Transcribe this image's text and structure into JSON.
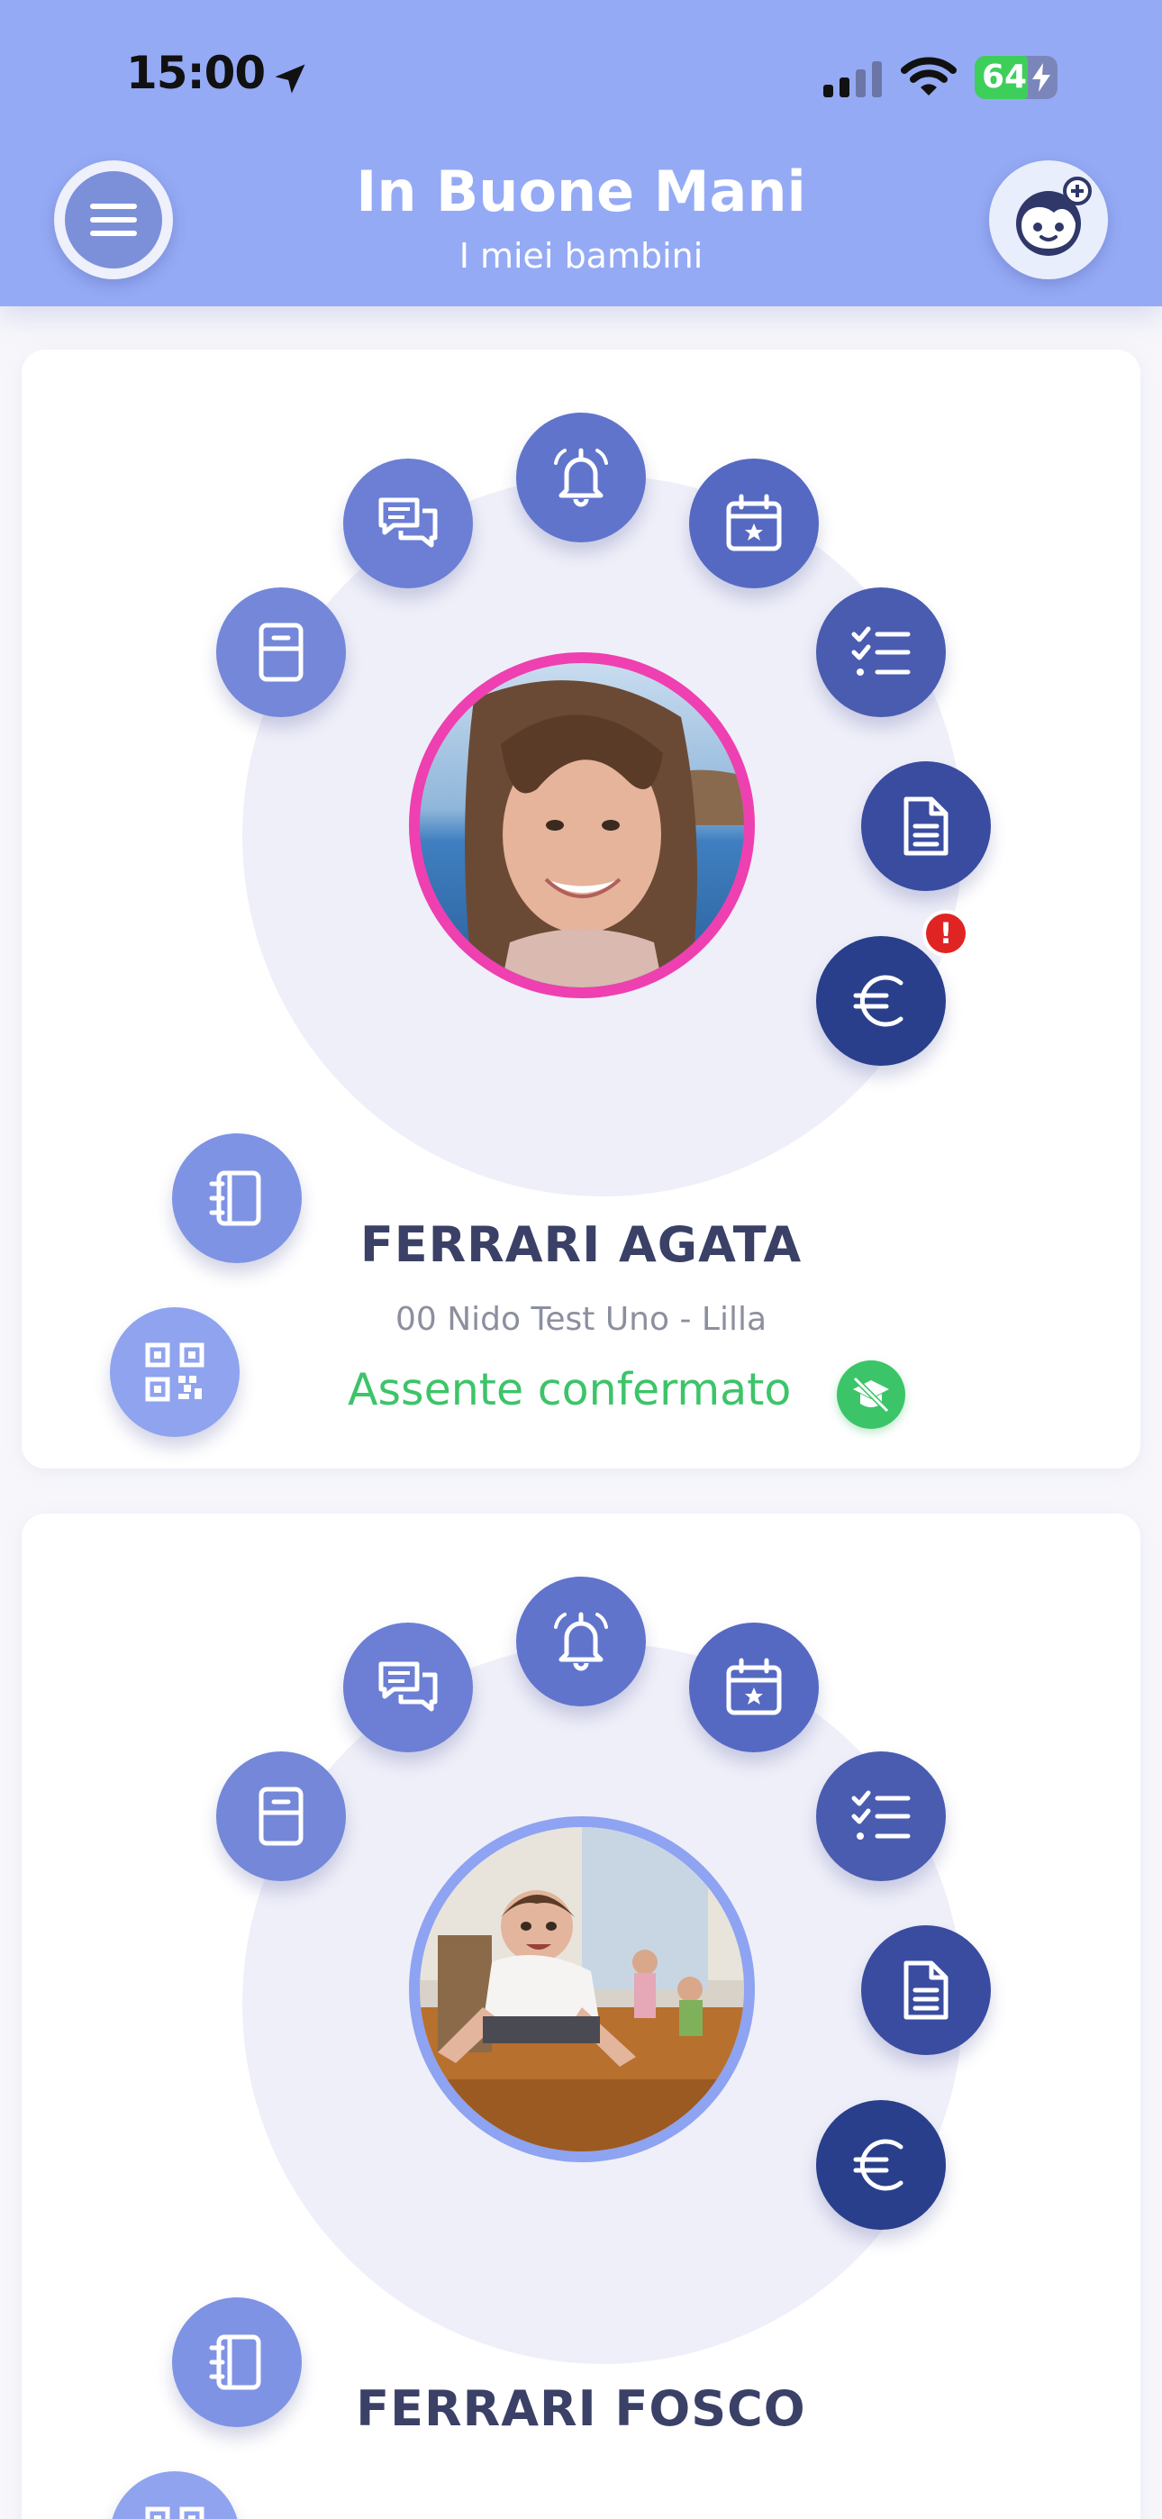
{
  "status_bar": {
    "time": "15:00",
    "battery": "64",
    "battery_level": 0.64
  },
  "header": {
    "title": "In Buone Mani",
    "subtitle": "I miei bambini"
  },
  "colors": {
    "header": "#95aaf5",
    "action_light": "#8fa3ee",
    "action_mid": "#6c7fd4",
    "action_deep": "#4a5cb0",
    "action_dark": "#293f8c",
    "status_green": "#3cc469",
    "photo_ring_pink": "#ee40b0",
    "photo_ring_blue": "#8ea3f1"
  },
  "actions": [
    {
      "id": "qr",
      "icon": "qr-code-icon"
    },
    {
      "id": "diary",
      "icon": "notebook-icon"
    },
    {
      "id": "locker",
      "icon": "locker-icon"
    },
    {
      "id": "chat",
      "icon": "chat-icon"
    },
    {
      "id": "alerts",
      "icon": "bell-icon"
    },
    {
      "id": "calendar",
      "icon": "calendar-icon"
    },
    {
      "id": "checklist",
      "icon": "checklist-icon"
    },
    {
      "id": "document",
      "icon": "document-icon"
    },
    {
      "id": "payments",
      "icon": "euro-icon"
    }
  ],
  "children": [
    {
      "name": "FERRARI AGATA",
      "class": "00 Nido Test Uno - Lilla",
      "status": "Assente confermato",
      "payment_alert": "!"
    },
    {
      "name": "FERRARI FOSCO"
    }
  ]
}
